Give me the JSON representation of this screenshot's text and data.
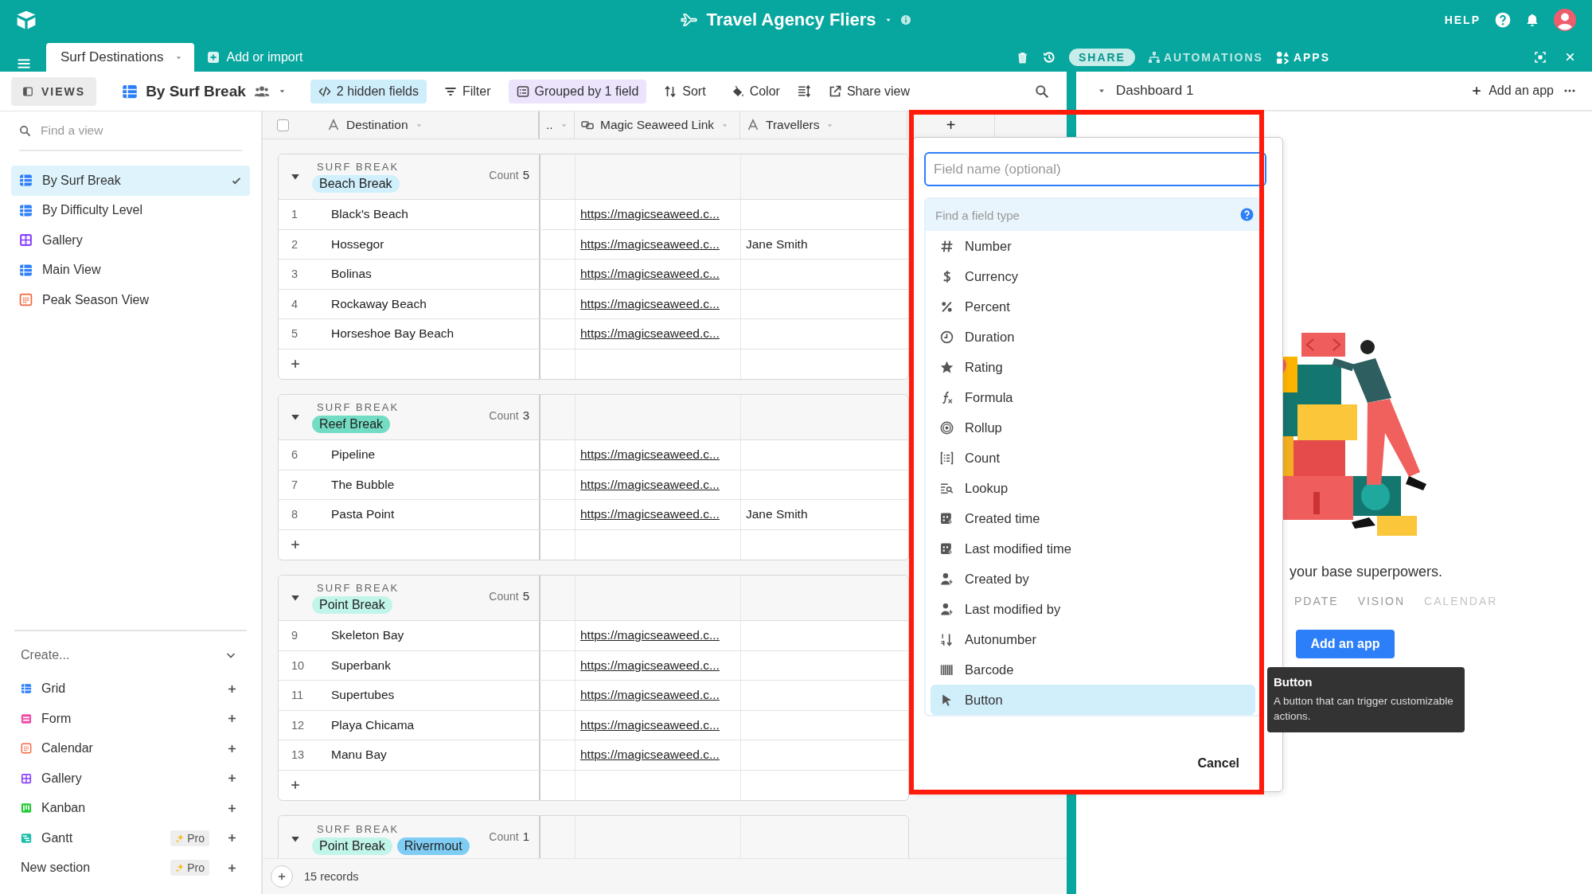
{
  "topbar": {
    "title": "Travel Agency Fliers",
    "help": "HELP"
  },
  "tabs": [
    {
      "label": "Surf Destinations",
      "selected": true
    }
  ],
  "add_or_import": "Add or import",
  "header_actions": {
    "share": "SHARE",
    "automations": "AUTOMATIONS",
    "apps": "APPS"
  },
  "view_bar": {
    "views_button": "VIEWS",
    "current_view": "By Surf Break",
    "tools": [
      {
        "kind": "hidden",
        "label": "2 hidden fields",
        "active": true
      },
      {
        "kind": "filter",
        "label": "Filter",
        "active": false
      },
      {
        "kind": "group",
        "label": "Grouped by 1 field",
        "active": true
      },
      {
        "kind": "sort",
        "label": "Sort",
        "active": false
      },
      {
        "kind": "color",
        "label": "Color",
        "active": false
      },
      {
        "kind": "share",
        "label": "Share view",
        "active": false
      }
    ]
  },
  "sidebar": {
    "search_placeholder": "Find a view",
    "views": [
      {
        "label": "By Surf Break",
        "kind": "grid",
        "selected": true
      },
      {
        "label": "By Difficulty Level",
        "kind": "grid",
        "selected": false
      },
      {
        "label": "Gallery",
        "kind": "gallery",
        "selected": false
      },
      {
        "label": "Main View",
        "kind": "grid",
        "selected": false
      },
      {
        "label": "Peak Season View",
        "kind": "calendar",
        "selected": false
      }
    ],
    "create_label": "Create...",
    "create_items": [
      {
        "label": "Grid",
        "kind": "grid"
      },
      {
        "label": "Form",
        "kind": "form"
      },
      {
        "label": "Calendar",
        "kind": "calendar"
      },
      {
        "label": "Gallery",
        "kind": "gallery"
      },
      {
        "label": "Kanban",
        "kind": "kanban"
      },
      {
        "label": "Gantt",
        "kind": "gantt",
        "badge": "Pro"
      }
    ],
    "new_section": {
      "label": "New section",
      "badge": "Pro"
    }
  },
  "grid": {
    "columns": [
      {
        "name": "Destination",
        "kind": "text"
      },
      {
        "name": "..",
        "kind": "collapsed"
      },
      {
        "name": "Magic Seaweed Link",
        "kind": "link"
      },
      {
        "name": "Travellers",
        "kind": "text"
      }
    ],
    "add_field": "+",
    "groups": [
      {
        "field_label": "SURF BREAK",
        "tags": [
          {
            "label": "Beach Break",
            "color": "#d0f0fd"
          }
        ],
        "count_label": "Count",
        "count": "5",
        "rows": [
          {
            "number": "1",
            "destination": "Black's Beach",
            "link": "https://magicseaweed.c..."
          },
          {
            "number": "2",
            "destination": "Hossegor",
            "link": "https://magicseaweed.c...",
            "travellers": "Jane Smith"
          },
          {
            "number": "3",
            "destination": "Bolinas",
            "link": "https://magicseaweed.c..."
          },
          {
            "number": "4",
            "destination": "Rockaway Beach",
            "link": "https://magicseaweed.c..."
          },
          {
            "number": "5",
            "destination": "Horseshoe Bay Beach",
            "link": "https://magicseaweed.c..."
          }
        ]
      },
      {
        "field_label": "SURF BREAK",
        "tags": [
          {
            "label": "Reef Break",
            "color": "#72ddc3"
          }
        ],
        "count_label": "Count",
        "count": "3",
        "rows": [
          {
            "number": "6",
            "destination": "Pipeline",
            "link": "https://magicseaweed.c..."
          },
          {
            "number": "7",
            "destination": "The Bubble",
            "link": "https://magicseaweed.c..."
          },
          {
            "number": "8",
            "destination": "Pasta Point",
            "link": "https://magicseaweed.c...",
            "travellers": "Jane Smith"
          }
        ]
      },
      {
        "field_label": "SURF BREAK",
        "tags": [
          {
            "label": "Point Break",
            "color": "#c2f5e9"
          }
        ],
        "count_label": "Count",
        "count": "5",
        "rows": [
          {
            "number": "9",
            "destination": "Skeleton Bay",
            "link": "https://magicseaweed.c..."
          },
          {
            "number": "10",
            "destination": "Superbank",
            "link": "https://magicseaweed.c..."
          },
          {
            "number": "11",
            "destination": "Supertubes",
            "link": "https://magicseaweed.c..."
          },
          {
            "number": "12",
            "destination": "Playa Chicama",
            "link": "https://magicseaweed.c..."
          },
          {
            "number": "13",
            "destination": "Manu Bay",
            "link": "https://magicseaweed.c..."
          }
        ]
      },
      {
        "field_label": "SURF BREAK",
        "tags": [
          {
            "label": "Point Break",
            "color": "#c2f5e9"
          },
          {
            "label": "Rivermout",
            "color": "#7fcdf4"
          }
        ],
        "count_label": "Count",
        "count": "1"
      }
    ],
    "select_all": {
      "checked": false
    },
    "record_count": "15 records"
  },
  "dashboard": {
    "title": "Dashboard 1",
    "add_app": "Add an app",
    "tagline": "your base superpowers.",
    "categories": [
      "PDATE",
      "VISION",
      "CALENDAR"
    ],
    "button": "Add an app"
  },
  "field_menu": {
    "name_placeholder": "Field name (optional)",
    "search_placeholder": "Find a field type",
    "types": [
      {
        "label": "Number",
        "kind": "number",
        "selected": false
      },
      {
        "label": "Currency",
        "kind": "currency",
        "selected": false
      },
      {
        "label": "Percent",
        "kind": "percent",
        "selected": false
      },
      {
        "label": "Duration",
        "kind": "duration",
        "selected": false
      },
      {
        "label": "Rating",
        "kind": "rating",
        "selected": false
      },
      {
        "label": "Formula",
        "kind": "formula",
        "selected": false
      },
      {
        "label": "Rollup",
        "kind": "rollup",
        "selected": false
      },
      {
        "label": "Count",
        "kind": "count",
        "selected": false
      },
      {
        "label": "Lookup",
        "kind": "lookup",
        "selected": false
      },
      {
        "label": "Created time",
        "kind": "created_time",
        "selected": false
      },
      {
        "label": "Last modified time",
        "kind": "modified_time",
        "selected": false
      },
      {
        "label": "Created by",
        "kind": "created_by",
        "selected": false
      },
      {
        "label": "Last modified by",
        "kind": "modified_by",
        "selected": false
      },
      {
        "label": "Autonumber",
        "kind": "autonumber",
        "selected": false
      },
      {
        "label": "Barcode",
        "kind": "barcode",
        "selected": false
      },
      {
        "label": "Button",
        "kind": "button",
        "selected": true
      }
    ],
    "cancel": "Cancel"
  },
  "tooltip": {
    "title": "Button",
    "text": "A button that can trigger customizable actions."
  }
}
